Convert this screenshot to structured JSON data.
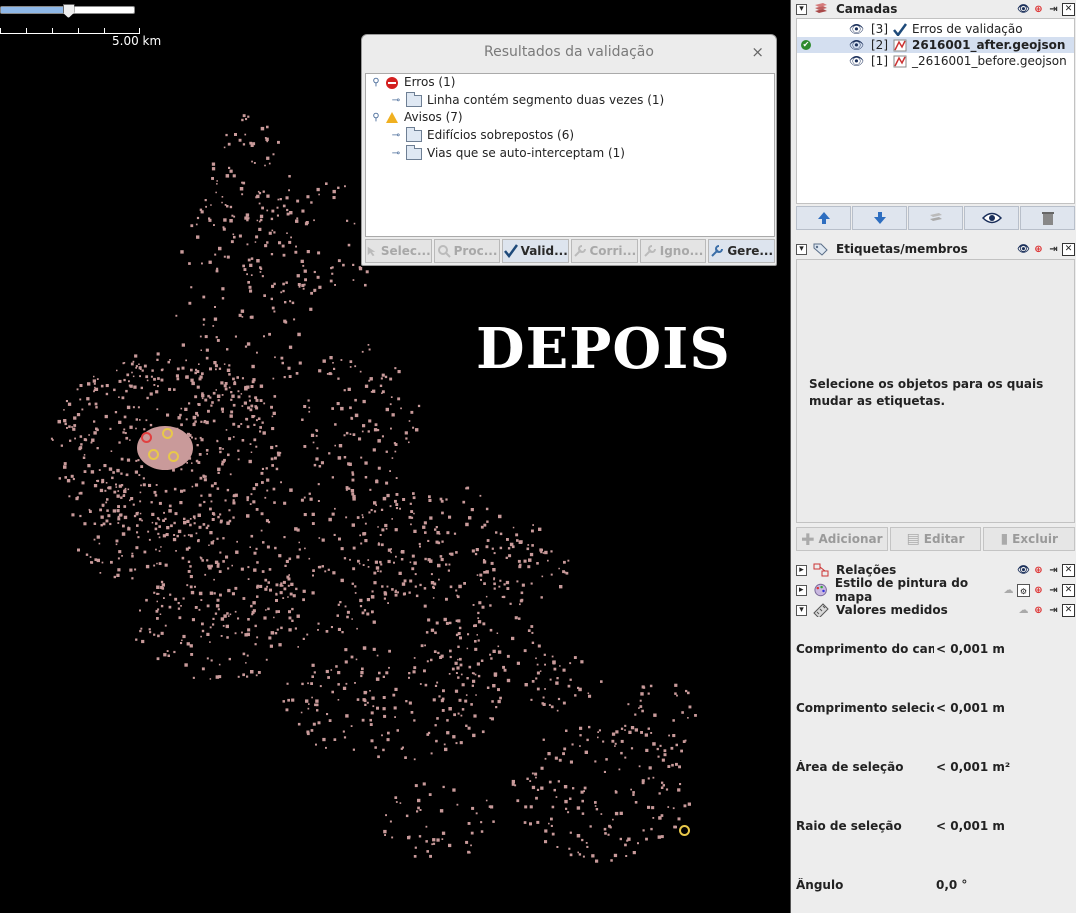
{
  "map": {
    "scale_label": "5.00 km",
    "overlay_text": "DEPOIS",
    "zoom_level": 0.5,
    "colors": {
      "background": "#000000",
      "features": "#c99a9a",
      "highlight": "#e8c84a"
    }
  },
  "validation_dialog": {
    "title": "Resultados da validação",
    "close": "×",
    "tree": {
      "errors": {
        "label": "Erros (1)",
        "children": [
          "Linha contém segmento duas vezes (1)"
        ]
      },
      "warnings": {
        "label": "Avisos (7)",
        "children": [
          "Edifícios sobrepostos (6)",
          "Vias que se auto-interceptam (1)"
        ]
      }
    },
    "buttons": [
      {
        "label": "Selec...",
        "icon": "select-icon",
        "enabled": false
      },
      {
        "label": "Proc...",
        "icon": "search-icon",
        "enabled": false
      },
      {
        "label": "Valid...",
        "icon": "checkmark-icon",
        "enabled": true
      },
      {
        "label": "Corri...",
        "icon": "wrench-icon",
        "enabled": false
      },
      {
        "label": "Igno...",
        "icon": "wrench-icon",
        "enabled": false
      },
      {
        "label": "Gere...",
        "icon": "wrench-icon",
        "enabled": true
      }
    ]
  },
  "panel": {
    "layers": {
      "title": "Camadas",
      "items": [
        {
          "index": "[3]",
          "name": "Erros de validação",
          "icon": "checkmark-icon",
          "selected": false,
          "active": false
        },
        {
          "index": "[2]",
          "name": "2616001_after.geojson",
          "icon": "data-layer-icon",
          "selected": true,
          "active": true
        },
        {
          "index": "[1]",
          "name": "_2616001_before.geojson",
          "icon": "data-layer-icon",
          "selected": false,
          "active": false
        }
      ],
      "toolbar": [
        "move-up-icon",
        "move-down-icon",
        "merge-icon",
        "visibility-icon",
        "delete-icon"
      ]
    },
    "tags": {
      "title": "Etiquetas/membros",
      "message": "Selecione os objetos para os quais mudar as etiquetas.",
      "buttons": [
        "Adicionar",
        "Editar",
        "Excluir"
      ]
    },
    "relations": {
      "title": "Relações"
    },
    "map_paint": {
      "title": "Estilo de pintura do mapa"
    },
    "measurements": {
      "title": "Valores medidos",
      "rows": [
        {
          "label": "Comprimento do cam...",
          "value": "< 0,001 m"
        },
        {
          "label": "Comprimento selecio...",
          "value": "< 0,001 m"
        },
        {
          "label": "Área de seleção",
          "value": "< 0,001 m²"
        },
        {
          "label": "Raio de seleção",
          "value": "< 0,001 m"
        },
        {
          "label": "Ângulo",
          "value": "0,0 °"
        }
      ]
    }
  }
}
